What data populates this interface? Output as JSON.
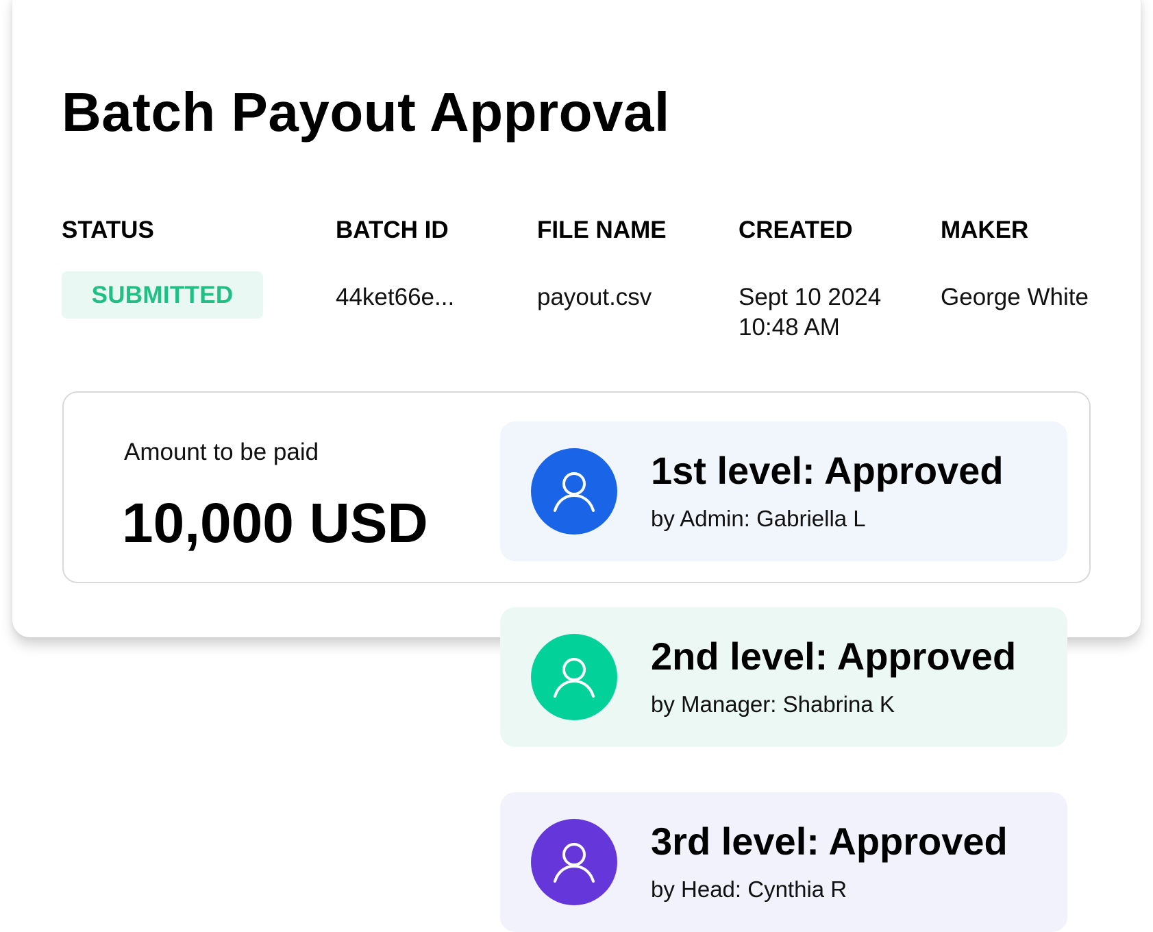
{
  "title": "Batch Payout Approval",
  "columns": {
    "status": "STATUS",
    "batch_id": "BATCH ID",
    "file_name": "FILE NAME",
    "created": "CREATED",
    "maker": "MAKER"
  },
  "details": {
    "status": "SUBMITTED",
    "batch_id": "44ket66e...",
    "file_name": "payout.csv",
    "created_date": "Sept 10 2024",
    "created_time": "10:48 AM",
    "maker": "George White"
  },
  "amount": {
    "label": "Amount to be paid",
    "value": "10,000 USD"
  },
  "approvals": [
    {
      "title": "1st level: Approved",
      "by": "by Admin: Gabriella L",
      "icon": "user-icon",
      "color": "#1a64e8",
      "bg": "#f1f6fd"
    },
    {
      "title": "2nd level: Approved",
      "by": "by Manager: Shabrina K",
      "icon": "user-icon",
      "color": "#03d19a",
      "bg": "#ecf8f4"
    },
    {
      "title": "3rd level: Approved",
      "by": "by Head: Cynthia R",
      "icon": "user-icon",
      "color": "#6537db",
      "bg": "#f2f2fd"
    }
  ],
  "colors": {
    "status_text": "#20bf86",
    "status_bg": "#e9f8f2",
    "border": "#d9d9d9"
  }
}
